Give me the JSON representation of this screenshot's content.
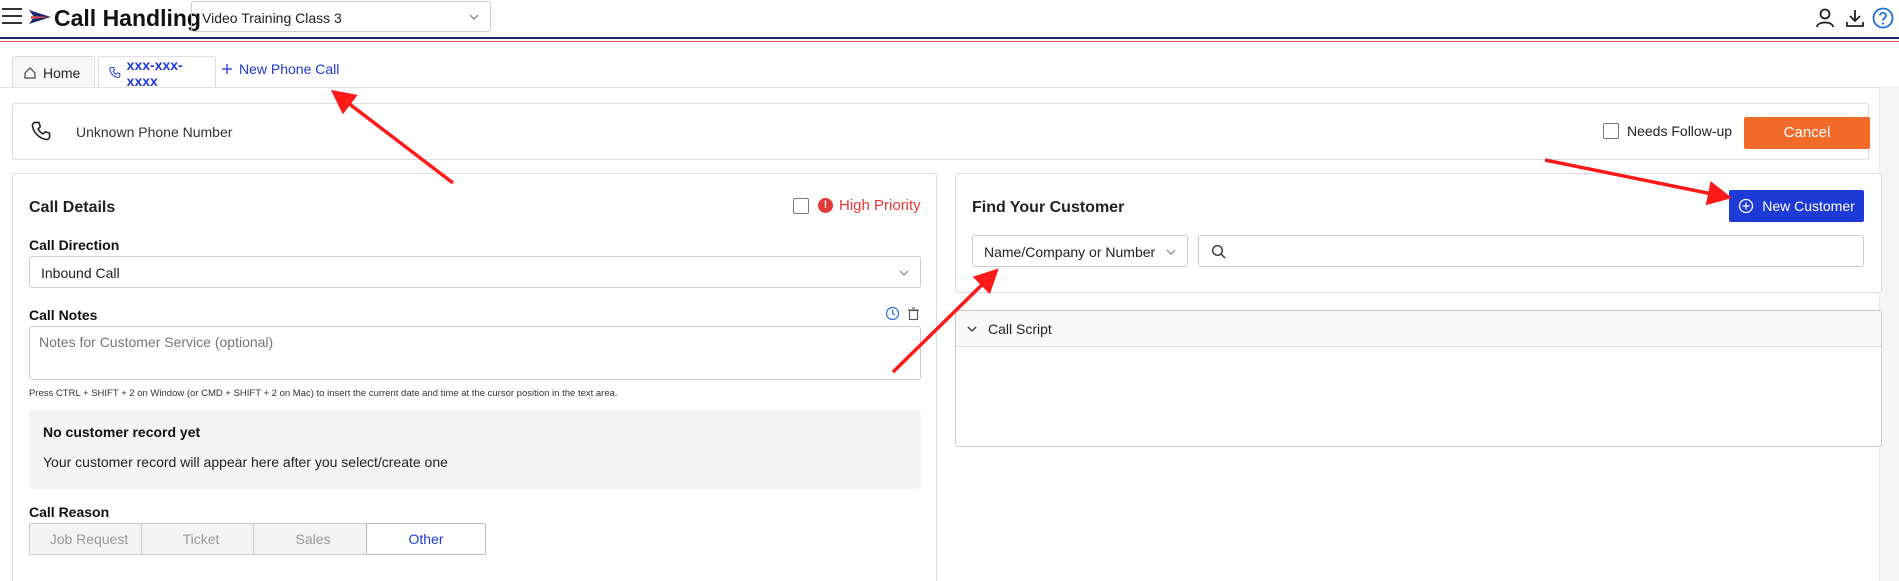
{
  "app": {
    "title": "Call Handling",
    "class_select": "Video Training Class 3"
  },
  "tabs": [
    {
      "label": "Home",
      "icon": "home-icon"
    },
    {
      "label": "xxx-xxx-xxxx",
      "icon": "phone-icon"
    }
  ],
  "new_call_label": "New Phone Call",
  "phone_bar": {
    "label": "Unknown Phone Number",
    "followup_label": "Needs Follow-up",
    "cancel_label": "Cancel"
  },
  "details": {
    "title": "Call Details",
    "high_priority_label": "High Priority",
    "direction_label": "Call Direction",
    "direction_value": "Inbound Call",
    "notes_label": "Call Notes",
    "notes_placeholder": "Notes for Customer Service (optional)",
    "hint": "Press CTRL + SHIFT + 2 on Window (or CMD + SHIFT + 2 on Mac) to insert the current date and time at the cursor position in the text area.",
    "no_record_title": "No customer record yet",
    "no_record_text": "Your customer record will appear here after you select/create one",
    "reason_label": "Call Reason",
    "reasons": [
      "Job Request",
      "Ticket",
      "Sales",
      "Other"
    ]
  },
  "find": {
    "title": "Find Your Customer",
    "new_customer_label": "New Customer",
    "search_type": "Name/Company or Number"
  },
  "script": {
    "title": "Call Script"
  },
  "colors": {
    "accent_blue": "#1e3ad6",
    "cancel_orange": "#f26b2a",
    "priority_red": "#e53935",
    "annotation_red": "#ff1a1a"
  }
}
